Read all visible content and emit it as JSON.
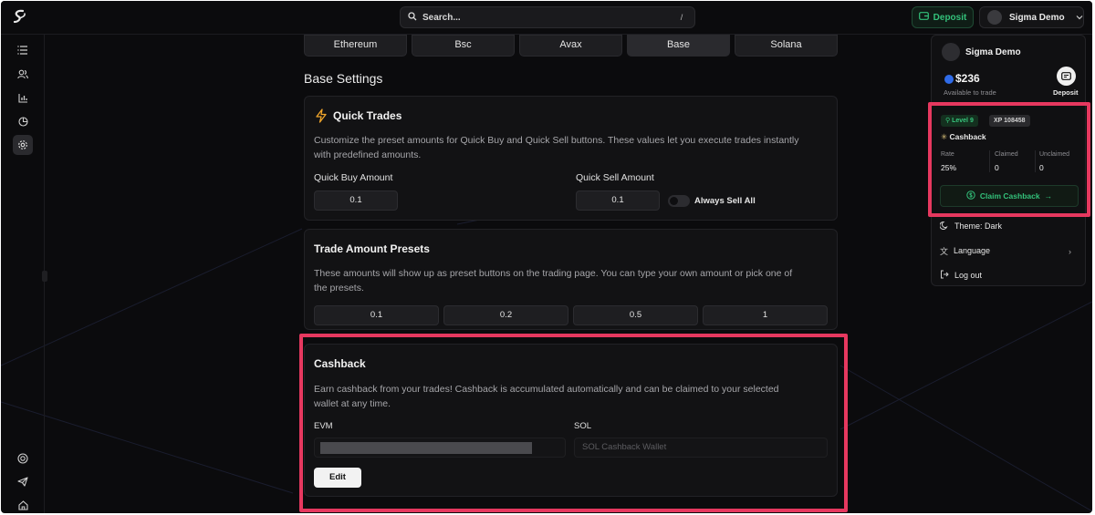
{
  "topbar": {
    "search_placeholder": "Search...",
    "search_shortcut": "/",
    "deposit_label": "Deposit",
    "user_name": "Sigma Demo"
  },
  "sidebar": {
    "items": [
      "menu-icon",
      "users-icon",
      "chart-icon",
      "pie-icon",
      "settings-icon"
    ],
    "bottom_items": [
      "support-icon",
      "telegram-icon",
      "home-icon"
    ]
  },
  "chains": {
    "tabs": [
      "Ethereum",
      "Bsc",
      "Avax",
      "Base",
      "Solana"
    ],
    "active": "Base"
  },
  "settings": {
    "title": "Base Settings",
    "quick_trades": {
      "title": "Quick Trades",
      "description_line1": "Customize the preset amounts for Quick Buy and Quick Sell buttons. These values let you execute trades instantly",
      "description_line2": "with predefined amounts.",
      "buy_label": "Quick Buy Amount",
      "buy_value": "0.1",
      "sell_label": "Quick Sell Amount",
      "sell_value": "0.1",
      "always_sell_label": "Always Sell All"
    },
    "presets": {
      "title": "Trade Amount Presets",
      "description_line1": "These amounts will show up as preset buttons on the trading page. You can type your own amount or pick one of",
      "description_line2": "the presets.",
      "values": [
        "0.1",
        "0.2",
        "0.5",
        "1"
      ]
    },
    "cashback": {
      "title": "Cashback",
      "description_line1": "Earn cashback from your trades! Cashback is accumulated automatically and can be claimed to your selected",
      "description_line2": "wallet at any time.",
      "evm_label": "EVM",
      "sol_label": "SOL",
      "sol_placeholder": "SOL Cashback Wallet",
      "edit_label": "Edit"
    }
  },
  "dropdown": {
    "user_name": "Sigma Demo",
    "balance": "$236",
    "balance_caption": "Available to trade",
    "deposit_label": "Deposit",
    "level_badge": "Level 9",
    "xp_badge": "XP 108458",
    "cashback_title": "Cashback",
    "rate_label": "Rate",
    "rate_value": "25%",
    "claimed_label": "Claimed",
    "claimed_value": "0",
    "unclaimed_label": "Unclaimed",
    "unclaimed_value": "0",
    "claim_label": "Claim Cashback",
    "theme_label": "Theme: Dark",
    "language_label": "Language",
    "logout_label": "Log out"
  },
  "colors": {
    "accent_green": "#33c17a",
    "highlight_pink": "#e6385f",
    "background": "#0b0b0d"
  }
}
